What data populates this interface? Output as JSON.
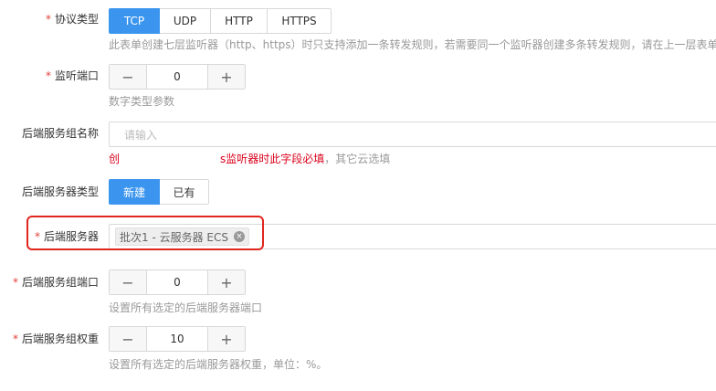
{
  "protocol": {
    "label": "协议类型",
    "required": "*",
    "options": [
      "TCP",
      "UDP",
      "HTTP",
      "HTTPS"
    ],
    "selected": "TCP",
    "hint": "此表单创建七层监听器（http、https）时只支持添加一条转发规则，若需要同一个监听器创建多条转发规则，请在上一层表单进"
  },
  "listen_port": {
    "label": "监听端口",
    "required": "*",
    "value": "0",
    "minus": "−",
    "plus": "+",
    "hint": "数字类型参数"
  },
  "group_name": {
    "label": "后端服务组名称",
    "placeholder": "请输入",
    "error_prefix": "创",
    "error_main": "s监听器时此字段必填",
    "error_suffix": "，其它云选填"
  },
  "server_type": {
    "label": "后端服务器类型",
    "options": [
      "新建",
      "已有"
    ],
    "selected": "新建"
  },
  "servers": {
    "label": "后端服务器",
    "required": "*",
    "tag": "批次1 - 云服务器 ECS",
    "tag_close": "×"
  },
  "group_port": {
    "label": "后端服务组端口",
    "required": "*",
    "value": "0",
    "minus": "−",
    "plus": "+",
    "hint": "设置所有选定的后端服务器端口"
  },
  "group_weight": {
    "label": "后端服务组权重",
    "required": "*",
    "value": "10",
    "minus": "−",
    "plus": "+",
    "hint": "设置所有选定的后端服务器权重，单位：%。"
  },
  "colors": {
    "accent": "#3b95ee",
    "required": "#e0413a",
    "error": "#d9001b",
    "highlight": "#e0261f"
  }
}
